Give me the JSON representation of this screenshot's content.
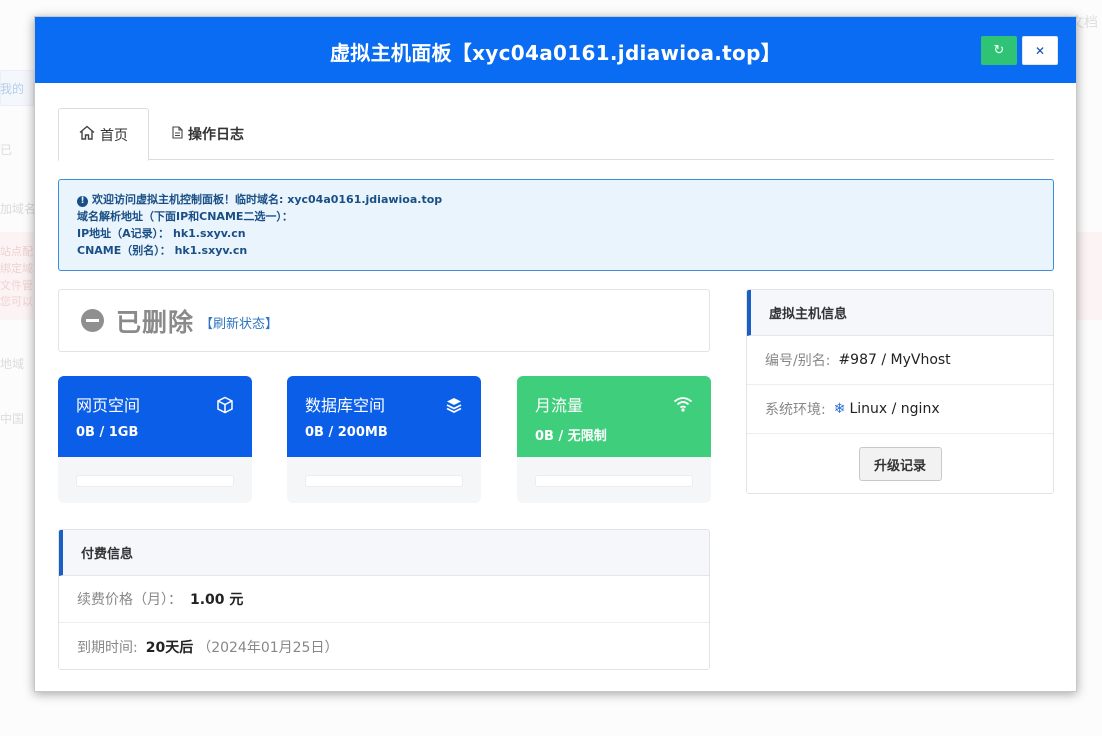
{
  "background": {
    "top_right_text": "文档",
    "side_texts": [
      "我的",
      "已",
      "加域名",
      "站点配",
      "绑定域",
      "文件管",
      "您可以",
      "地域",
      "中国"
    ]
  },
  "modal": {
    "title": "虚拟主机面板【xyc04a0161.jdiawioa.top】",
    "refresh_icon": "refresh-icon",
    "close_icon": "close-icon"
  },
  "tabs": [
    {
      "label": "首页",
      "icon": "home-icon"
    },
    {
      "label": "操作日志",
      "icon": "document-icon"
    }
  ],
  "notice": {
    "line1": "欢迎访问虚拟主机控制面板！临时域名: xyc04a0161.jdiawioa.top",
    "line2": "域名解析地址（下面IP和CNAME二选一）：",
    "line3": "IP地址（A记录）：  hk1.sxyv.cn",
    "line4": "CNAME（别名）：  hk1.sxyv.cn"
  },
  "status": {
    "text": "已删除",
    "refresh_link": "【刷新状态】"
  },
  "cards": [
    {
      "label": "网页空间",
      "value": "0B / 1GB",
      "icon": "cube-icon",
      "color": "#0a5ee8"
    },
    {
      "label": "数据库空间",
      "value": "0B / 200MB",
      "icon": "layers-icon",
      "color": "#0a5ee8"
    },
    {
      "label": "月流量",
      "value": "0B / 无限制",
      "icon": "wifi-icon",
      "color": "#3fce7c"
    }
  ],
  "payment": {
    "title": "付费信息",
    "renew_label": "续费价格（月）：",
    "renew_value": "1.00 元",
    "expire_label": "到期时间:",
    "expire_value": "20天后",
    "expire_date": "（2024年01月25日）"
  },
  "host_info": {
    "title": "虚拟主机信息",
    "id_label": "编号/别名:",
    "id_value": "#987 / MyVhost",
    "env_label": "系统环境:",
    "env_value": "Linux / nginx",
    "upgrade_button": "升级记录"
  }
}
